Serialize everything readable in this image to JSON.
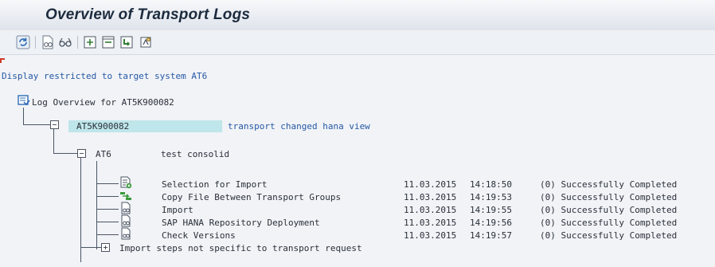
{
  "window": {
    "title": "Overview of Transport Logs"
  },
  "toolbar": {
    "icons": [
      "refresh-icon",
      "display-icon",
      "glasses-icon",
      "expand-icon",
      "collapse-icon",
      "import-icon",
      "settings-icon"
    ]
  },
  "info": {
    "restriction": "Display restricted to target system AT6"
  },
  "tree": {
    "root_label": "Log Overview for AT5K900082",
    "request": {
      "id": "AT5K900082",
      "description": "transport changed hana view"
    },
    "system": {
      "id": "AT6",
      "description": "test consolid"
    },
    "steps": [
      {
        "name": "Selection for Import",
        "date": "11.03.2015",
        "time": "14:18:50",
        "status": "(0) Successfully Completed",
        "icon": "selection-icon"
      },
      {
        "name": "Copy File Between Transport Groups",
        "date": "11.03.2015",
        "time": "14:19:53",
        "status": "(0) Successfully Completed",
        "icon": "copy-file-icon"
      },
      {
        "name": "Import",
        "date": "11.03.2015",
        "time": "14:19:55",
        "status": "(0) Successfully Completed",
        "icon": "log-document-icon"
      },
      {
        "name": "SAP HANA Repository Deployment",
        "date": "11.03.2015",
        "time": "14:19:56",
        "status": "(0) Successfully Completed",
        "icon": "log-document-icon"
      },
      {
        "name": "Check Versions",
        "date": "11.03.2015",
        "time": "14:19:57",
        "status": "(0) Successfully Completed",
        "icon": "log-document-icon"
      }
    ],
    "footer_node": "Import steps not specific to transport request"
  }
}
